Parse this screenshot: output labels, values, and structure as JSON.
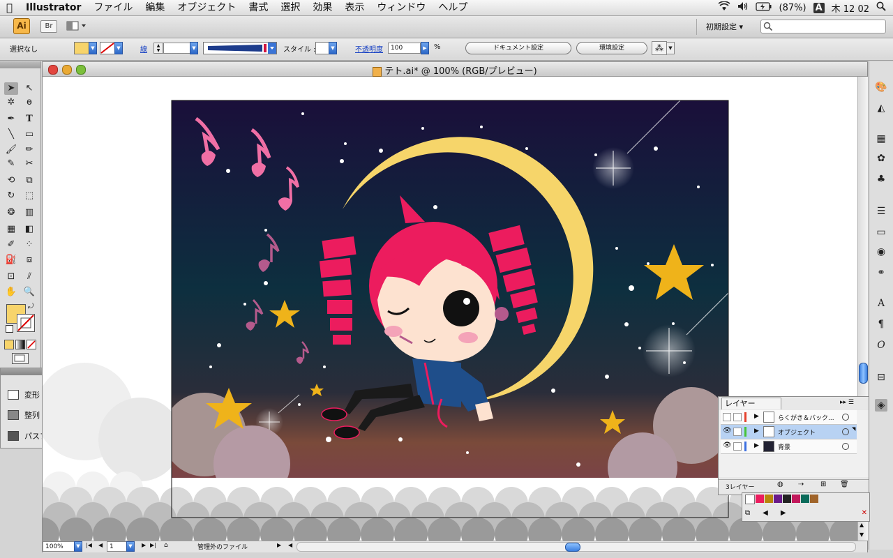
{
  "menubar": {
    "app_name": "Illustrator",
    "items": [
      "ファイル",
      "編集",
      "オブジェクト",
      "書式",
      "選択",
      "効果",
      "表示",
      "ウィンドウ",
      "ヘルプ"
    ],
    "battery": "(87%)",
    "input_mode": "A",
    "clock": "木 12 02"
  },
  "appbar": {
    "ai_label": "Ai",
    "br_label": "Br",
    "workspace": "初期設定 ▾"
  },
  "control": {
    "selection": "選択なし",
    "stroke_label": "線",
    "style_label": "スタイル :",
    "opacity_label": "不透明度",
    "opacity_value": "100",
    "percent": "%",
    "doc_settings": "ドキュメント設定",
    "preferences": "環境設定"
  },
  "document": {
    "title": "テト.ai* @ 100% (RGB/プレビュー)",
    "zoom": "100%",
    "page": "1",
    "status": "管理外のファイル"
  },
  "transform_panel": {
    "items": [
      "変形",
      "整列",
      "パスファインダ"
    ]
  },
  "layers": {
    "tab": "レイヤー",
    "rows": [
      "らくがき＆バック...",
      "オブジェクト",
      "背景"
    ],
    "count": "3レイヤー"
  },
  "colors": {
    "fill": "#f7d46b",
    "sky_top": "#1a0f3a",
    "sky_mid": "#0d2f3f",
    "moon": "#f6d56a",
    "star": "#efb31a",
    "hair": "#ec1c5e",
    "note": "#f06fa5"
  },
  "icons": [
    "apple-icon",
    "wifi-icon",
    "volume-icon",
    "battery-icon",
    "search-icon"
  ]
}
